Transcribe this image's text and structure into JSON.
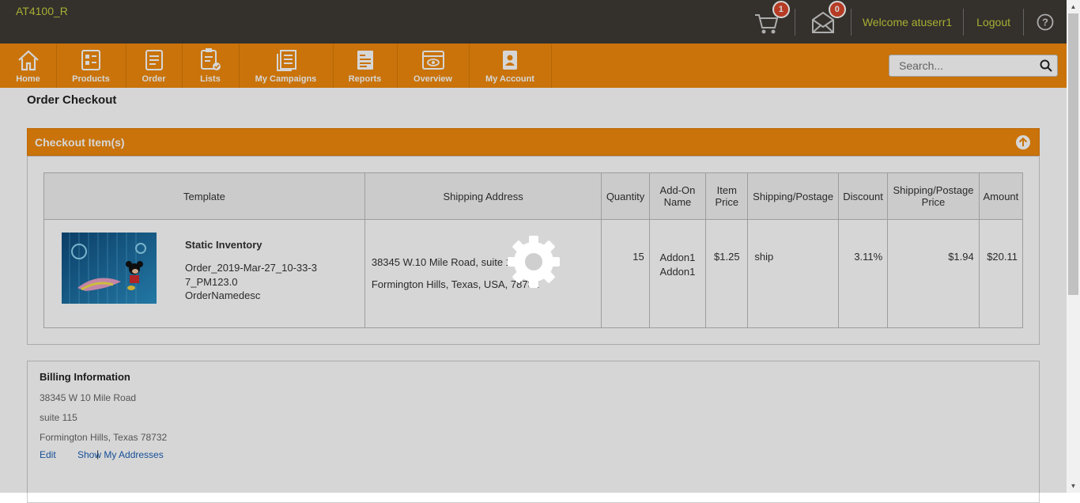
{
  "header": {
    "site_code": "AT4100_R",
    "cart_count": "1",
    "message_count": "0",
    "welcome": "Welcome atuserr1",
    "logout": "Logout"
  },
  "nav": {
    "items": [
      {
        "label": "Home",
        "icon": "home-icon"
      },
      {
        "label": "Products",
        "icon": "products-icon"
      },
      {
        "label": "Order",
        "icon": "order-icon"
      },
      {
        "label": "Lists",
        "icon": "lists-icon"
      },
      {
        "label": "My Campaigns",
        "icon": "campaigns-icon"
      },
      {
        "label": "Reports",
        "icon": "reports-icon"
      },
      {
        "label": "Overview",
        "icon": "overview-icon"
      },
      {
        "label": "My Account",
        "icon": "account-icon"
      }
    ],
    "search_placeholder": "Search..."
  },
  "page": {
    "title": "Order Checkout"
  },
  "checkout": {
    "panel_title": "Checkout Item(s)",
    "columns": [
      "Template",
      "Shipping Address",
      "Quantity",
      "Add-On Name",
      "Item Price",
      "Shipping/Postage",
      "Discount",
      "Shipping/Postage Price",
      "Amount"
    ],
    "row": {
      "template_name": "Static Inventory",
      "order_name": "Order_2019-Mar-27_10-33-37_PM123.0",
      "order_desc": "OrderNamedesc",
      "address_line1": "38345 W.10 Mile Road, suite 115",
      "address_line2": "Formington Hills, Texas, USA, 78732",
      "quantity": "15",
      "addon1": "Addon1",
      "addon2": "Addon1",
      "item_price": "$1.25",
      "shipping": "ship",
      "discount": "3.11%",
      "shipping_price": "$1.94",
      "amount": "$20.11"
    }
  },
  "billing": {
    "title": "Billing Information",
    "line1": "38345 W 10 Mile Road",
    "line2": "suite 115",
    "line3": "Formington Hills, Texas 78732",
    "edit": "Edit",
    "separator": "|",
    "show_addresses": "Show My Addresses"
  },
  "colors": {
    "topbar": "#3f3a35",
    "nav": "#f08a0d",
    "accent_text": "#c6cf3c",
    "badge": "#d9472b",
    "link": "#1b5fb5"
  }
}
